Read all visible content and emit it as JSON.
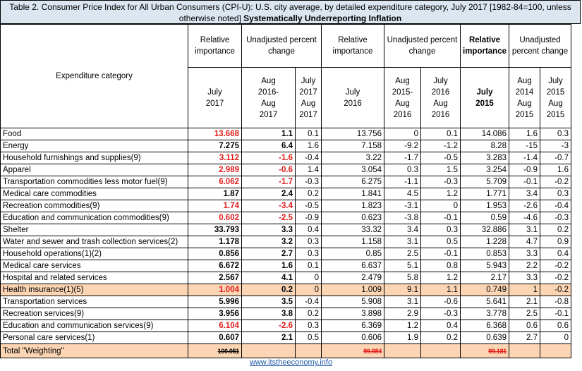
{
  "title": {
    "line1": "Table 2. Consumer Price Index for All Urban Consumers (CPI-U): U.S. city average, by detailed expenditure category,  July 2017 [1982-84=100, unless",
    "line2a": "otherwise noted] ",
    "line2b": "Systematically Underreporting Inflation"
  },
  "headers": {
    "category": "Expenditure category",
    "rel_imp": "Relative importance",
    "unadj": "Unadjusted percent change",
    "col1": "July 2017",
    "col2": "Aug 2016- Aug 2017",
    "col3": "July 2017 Aug 2017",
    "col4": "July 2016",
    "col5": "Aug 2015- Aug 2016",
    "col6": "July 2016 Aug 2016",
    "col7": "July 2015",
    "col8": "Aug 2014 Aug 2015",
    "col9": "July 2015 Aug 2015"
  },
  "rows": [
    {
      "cat": "Food",
      "v": [
        "13.668",
        "1.1",
        "0.1",
        "13.756",
        "0",
        "0.1",
        "14.086",
        "1.6",
        "0.3"
      ],
      "red": [
        true,
        false
      ]
    },
    {
      "cat": "Energy",
      "v": [
        "7.275",
        "6.4",
        "1.6",
        "7.158",
        "-9.2",
        "-1.2",
        "8.28",
        "-15",
        "-3"
      ],
      "red": [
        false,
        false
      ]
    },
    {
      "cat": "Household furnishings and supplies(9)",
      "v": [
        "3.112",
        "-1.6",
        "-0.4",
        "3.22",
        "-1.7",
        "-0.5",
        "3.283",
        "-1.4",
        "-0.7"
      ],
      "red": [
        true,
        true
      ]
    },
    {
      "cat": "Apparel",
      "v": [
        "2.989",
        "-0.6",
        "1.4",
        "3.054",
        "0.3",
        "1.5",
        "3.254",
        "-0.9",
        "1.6"
      ],
      "red": [
        true,
        true
      ]
    },
    {
      "cat": "Transportation commodities less motor fuel(9)",
      "v": [
        "6.062",
        "-1.7",
        "-0.3",
        "6.275",
        "-1.1",
        "-0.3",
        "5.709",
        "-0.1",
        "-0.2"
      ],
      "red": [
        true,
        true
      ]
    },
    {
      "cat": "Medical care commodities",
      "v": [
        "1.87",
        "2.4",
        "0.2",
        "1.841",
        "4.5",
        "1.2",
        "1.771",
        "3.4",
        "0.3"
      ],
      "red": [
        false,
        false
      ]
    },
    {
      "cat": "Recreation commodities(9)",
      "v": [
        "1.74",
        "-3.4",
        "-0.5",
        "1.823",
        "-3.1",
        "0",
        "1.953",
        "-2.6",
        "-0.4"
      ],
      "red": [
        true,
        true
      ]
    },
    {
      "cat": "Education and communication commodities(9)",
      "v": [
        "0.602",
        "-2.5",
        "-0.9",
        "0.623",
        "-3.8",
        "-0.1",
        "0.59",
        "-4.6",
        "-0.3"
      ],
      "red": [
        true,
        true
      ]
    },
    {
      "cat": "Shelter",
      "v": [
        "33.793",
        "3.3",
        "0.4",
        "33.32",
        "3.4",
        "0.3",
        "32.886",
        "3.1",
        "0.2"
      ],
      "red": [
        false,
        false
      ]
    },
    {
      "cat": "Water and sewer and trash collection services(2)",
      "v": [
        "1.178",
        "3.2",
        "0.3",
        "1.158",
        "3.1",
        "0.5",
        "1.228",
        "4.7",
        "0.9"
      ],
      "red": [
        false,
        false
      ]
    },
    {
      "cat": "Household operations(1)(2)",
      "v": [
        "0.856",
        "2.7",
        "0.3",
        "0.85",
        "2.5",
        "-0.1",
        "0.853",
        "3.3",
        "0.4"
      ],
      "red": [
        false,
        false
      ]
    },
    {
      "cat": "Medical care services",
      "v": [
        "6.672",
        "1.6",
        "0.1",
        "6.637",
        "5.1",
        "0.8",
        "5.943",
        "2.2",
        "-0.2"
      ],
      "red": [
        false,
        false
      ]
    },
    {
      "cat": "Hospital and related services",
      "v": [
        "2.567",
        "4.1",
        "0",
        "2.479",
        "5.8",
        "1.2",
        "2.17",
        "3.3",
        "-0.2"
      ],
      "red": [
        false,
        false
      ]
    },
    {
      "cat": "Health insurance(1)(5)",
      "v": [
        "1.004",
        "0.2",
        "0",
        "1.009",
        "9.1",
        "1.1",
        "0.749",
        "1",
        "-0.2"
      ],
      "red": [
        true,
        false
      ],
      "highlight": true
    },
    {
      "cat": "Transportation services",
      "v": [
        "5.996",
        "3.5",
        "-0.4",
        "5.908",
        "3.1",
        "-0.6",
        "5.641",
        "2.1",
        "-0.8"
      ],
      "red": [
        false,
        false
      ]
    },
    {
      "cat": "Recreation services(9)",
      "v": [
        "3.956",
        "3.8",
        "0.2",
        "3.898",
        "2.9",
        "-0.3",
        "3.778",
        "2.5",
        "-0.1"
      ],
      "red": [
        false,
        false
      ]
    },
    {
      "cat": "Education and communication services(9)",
      "v": [
        "6.104",
        "-2.6",
        "0.3",
        "6.369",
        "1.2",
        "0.4",
        "6.368",
        "0.6",
        "0.6"
      ],
      "red": [
        true,
        true
      ]
    },
    {
      "cat": "Personal care services(1)",
      "v": [
        "0.607",
        "2.1",
        "0.5",
        "0.606",
        "1.9",
        "0.2",
        "0.639",
        "2.7",
        "0"
      ],
      "red": [
        false,
        false
      ]
    }
  ],
  "total": {
    "cat": "Total \"Weighting\"",
    "c1": "100.051",
    "c4": "99.984",
    "c7": "99.181"
  },
  "footer": "www.itstheeconomy.info",
  "colors": {
    "header_bg": "#dce6f1",
    "highlight": "#fcd5b4",
    "red": "#e21a1a",
    "link": "#1f5aa8"
  }
}
